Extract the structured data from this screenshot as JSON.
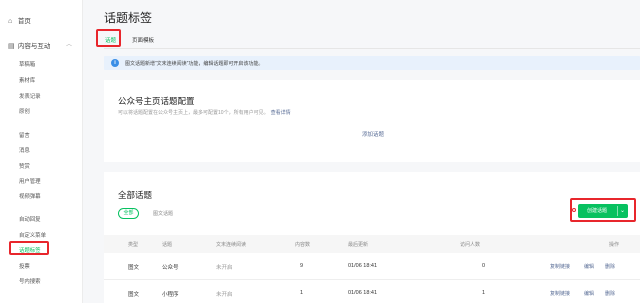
{
  "sidebar": {
    "home": "首页",
    "section": "内容与互动",
    "items": [
      "草稿箱",
      "素材库",
      "发表记录",
      "原创",
      "留言",
      "消息",
      "赞赏",
      "用户管理",
      "视频弹幕",
      "自动回复",
      "自定义菜单",
      "话题标签",
      "投票",
      "号内搜索"
    ],
    "active_index": 11
  },
  "header": {
    "title": "话题标签",
    "tabs": [
      "话题",
      "页面模板"
    ]
  },
  "notice": {
    "text": "图文话题新增“文末连续阅读”功能，编辑话题即可开启该功能。"
  },
  "config": {
    "title": "公众号主页话题配置",
    "desc": "可以将话题配置在公众号主页上，最多可配置10个，所有用户可见。",
    "link": "查看详情",
    "add": "添加话题"
  },
  "all": {
    "title": "全部话题",
    "filters": [
      "全部",
      "图文话题"
    ],
    "create_button": "创建话题"
  },
  "table": {
    "columns": [
      "类型",
      "话题",
      "文末连续阅读",
      "内容数",
      "最后更新",
      "访问人数",
      "操作"
    ],
    "rows": [
      {
        "type": "图文",
        "topic": "公众号",
        "reading": "未开启",
        "count": "9",
        "updated": "01/06 18:41",
        "visitors": "0",
        "actions": [
          "复制链接",
          "编辑",
          "删除"
        ]
      },
      {
        "type": "图文",
        "topic": "小程序",
        "reading": "未开启",
        "count": "1",
        "updated": "01/06 18:41",
        "visitors": "1",
        "actions": [
          "复制链接",
          "编辑",
          "删除"
        ]
      }
    ]
  },
  "colors": {
    "accent": "#07c160",
    "highlight": "#e8262c",
    "link": "#576b95"
  },
  "icons": {
    "home": "home-icon",
    "content": "document-icon",
    "notice": "info-icon",
    "caret": "chevron-down-icon"
  }
}
